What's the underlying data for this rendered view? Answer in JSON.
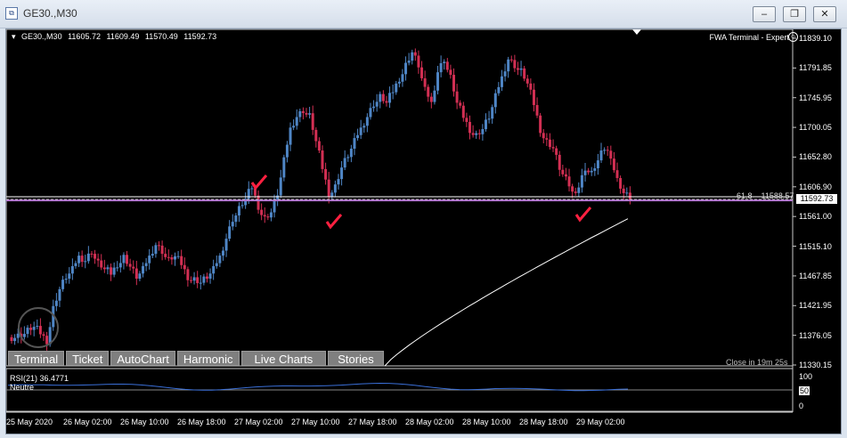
{
  "window": {
    "title": "GE30.,M30",
    "icon": "chart-icon"
  },
  "header": {
    "symbol": "GE30.,M30",
    "ohlc": [
      "11605.72",
      "11609.49",
      "11570.49",
      "11592.73"
    ],
    "expert": "FWA Terminal - Expert"
  },
  "price_axis": [
    "11839.10",
    "11791.85",
    "11745.95",
    "11700.05",
    "11652.80",
    "11606.90",
    "11561.00",
    "11515.10",
    "11467.85",
    "11421.95",
    "11376.05",
    "11330.15"
  ],
  "current_price": "11592.73",
  "fib_label": "61.8",
  "fib_price": "11588.57",
  "tabs": [
    "Terminal",
    "Ticket",
    "AutoChart",
    "Harmonic",
    "Live Charts",
    "Stories"
  ],
  "close_timer": "Close in 19m 25s",
  "rsi": {
    "label": "RSI(21) 36.4771",
    "state": "Neutre",
    "levels": [
      "100",
      "50",
      "0"
    ]
  },
  "date_axis": [
    "25 May 2020",
    "26 May 02:00",
    "26 May 10:00",
    "26 May 18:00",
    "27 May 02:00",
    "27 May 10:00",
    "27 May 18:00",
    "28 May 02:00",
    "28 May 10:00",
    "28 May 18:00",
    "29 May 02:00"
  ],
  "colors": {
    "bull": "#4f86c6",
    "bear": "#d32f53",
    "ma": "#ffffff",
    "fib_line": "#b06fd0",
    "rsi": "#3a6fd8",
    "check": "#ff2040"
  },
  "chart_data": {
    "type": "candlestick",
    "ylim": [
      11330.15,
      11839.1
    ],
    "close_path": [
      11375,
      11380,
      11385,
      11390,
      11382,
      11370,
      11420,
      11450,
      11470,
      11480,
      11500,
      11495,
      11510,
      11490,
      11480,
      11475,
      11490,
      11500,
      11485,
      11470,
      11480,
      11500,
      11520,
      11510,
      11495,
      11500,
      11490,
      11470,
      11465,
      11460,
      11470,
      11480,
      11500,
      11530,
      11560,
      11575,
      11590,
      11610,
      11580,
      11560,
      11570,
      11600,
      11650,
      11700,
      11720,
      11730,
      11720,
      11680,
      11640,
      11600,
      11610,
      11640,
      11660,
      11680,
      11700,
      11720,
      11740,
      11750,
      11740,
      11760,
      11780,
      11800,
      11820,
      11800,
      11760,
      11740,
      11790,
      11810,
      11780,
      11740,
      11720,
      11700,
      11690,
      11700,
      11720,
      11750,
      11780,
      11810,
      11800,
      11790,
      11770,
      11740,
      11700,
      11680,
      11670,
      11640,
      11620,
      11600,
      11610,
      11640,
      11630,
      11650,
      11670,
      11660,
      11620,
      11600,
      11592
    ],
    "ma_from_to": [
      [
        11330,
        11560
      ]
    ],
    "fib_level": 11588.57,
    "rsi_value": 36.4771
  }
}
